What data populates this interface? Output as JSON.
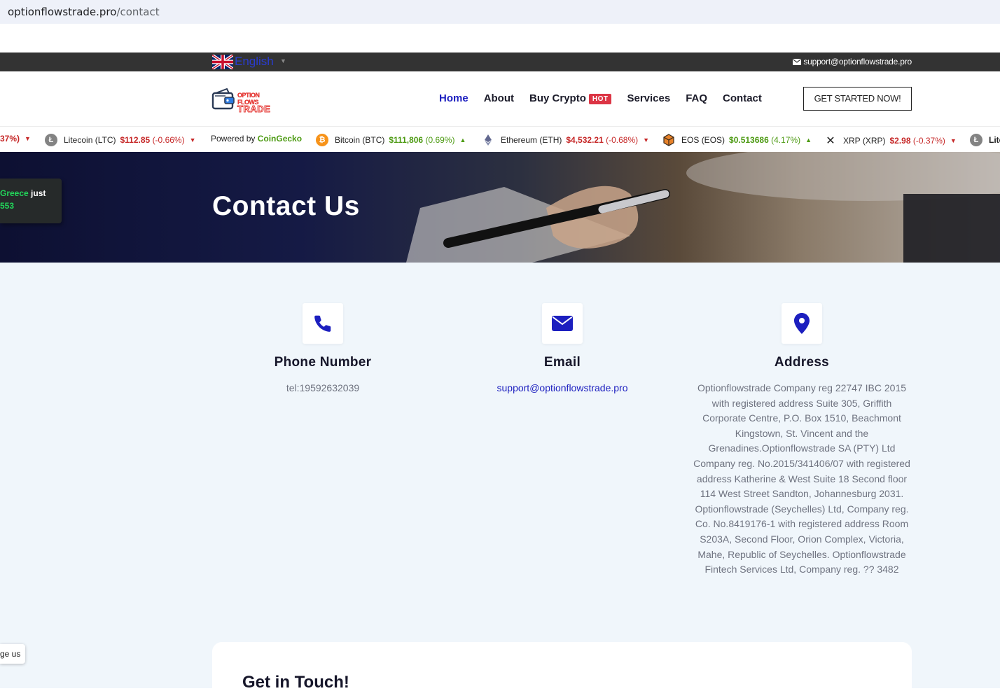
{
  "browser": {
    "url_host": "optionflowstrade.pro",
    "url_path": "/contact"
  },
  "topbar": {
    "language": "English",
    "email": "support@optionflowstrade.pro"
  },
  "logo": {
    "line1": "OPTION FLOWS",
    "line2": "TRADE"
  },
  "nav": {
    "items": [
      {
        "label": "Home",
        "active": true
      },
      {
        "label": "About"
      },
      {
        "label": "Buy Crypto",
        "badge": "HOT"
      },
      {
        "label": "Services"
      },
      {
        "label": "FAQ"
      },
      {
        "label": "Contact"
      }
    ],
    "cta": "GET STARTED NOW!"
  },
  "ticker": {
    "powered_prefix": "Powered by",
    "powered_brand": "CoinGecko",
    "head_tail": "37%)",
    "coins": [
      {
        "name": "Litecoin",
        "symbol": "(LTC)",
        "price": "$112.85",
        "change": "(-0.66%)",
        "dir": "down"
      },
      {
        "name": "Bitcoin",
        "symbol": "(BTC)",
        "price": "$111,806",
        "change": "(0.69%)",
        "dir": "up"
      },
      {
        "name": "Ethereum",
        "symbol": "(ETH)",
        "price": "$4,532.21",
        "change": "(-0.68%)",
        "dir": "down"
      },
      {
        "name": "EOS",
        "symbol": "(EOS)",
        "price": "$0.513686",
        "change": "(4.17%)",
        "dir": "up"
      },
      {
        "name": "XRP",
        "symbol": "(XRP)",
        "price": "$2.98",
        "change": "(-0.37%)",
        "dir": "down"
      }
    ],
    "tail": "Lite"
  },
  "hero": {
    "title": "Contact Us"
  },
  "toast": {
    "country": "Greece",
    "suffix": "just",
    "amount": "553"
  },
  "contact": {
    "phone": {
      "title": "Phone Number",
      "value": "tel:19592632039"
    },
    "email": {
      "title": "Email",
      "value": "support@optionflowstrade.pro"
    },
    "address": {
      "title": "Address",
      "value": "Optionflowstrade Company reg 22747 IBC 2015 with registered address Suite 305, Griffith Corporate Centre, P.O. Box 1510, Beachmont Kingstown, St. Vincent and the Grenadines.Optionflowstrade SA (PTY) Ltd Company reg. No.2015/341406/07 with registered address Katherine & West Suite 18 Second floor 114 West Street Sandton, Johannesburg 2031. Optionflowstrade (Seychelles) Ltd, Company reg. Co. No.8419176-1 with registered address Room S203A, Second Floor, Orion Complex, Victoria, Mahe, Republic of Seychelles. Optionflowstrade Fintech Services Ltd, Company reg. ?? 3482"
    }
  },
  "get_in_touch": {
    "title": "Get in Touch!"
  },
  "message_button": {
    "label": "ge us"
  },
  "colors": {
    "accent": "#1c1fbf",
    "hot": "#dc3545",
    "topbar": "#333333",
    "section_bg": "#f0f6fb"
  }
}
